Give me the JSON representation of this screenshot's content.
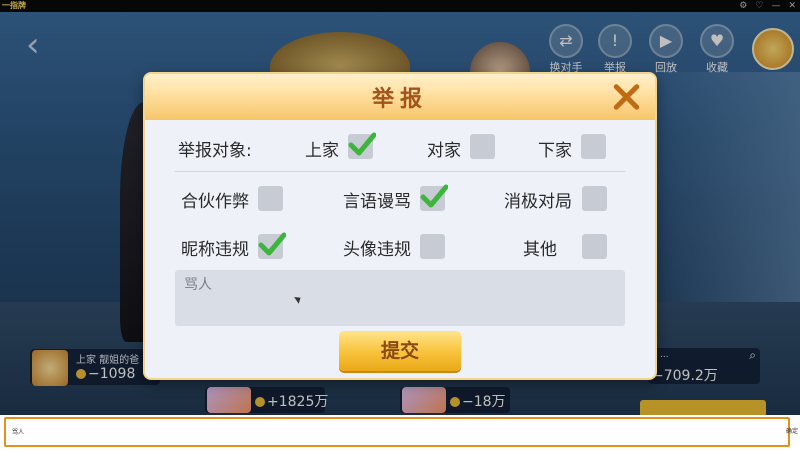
{
  "window": {
    "app_title": "一指牌",
    "controls": [
      "⚙",
      "♡",
      "—",
      "✕"
    ]
  },
  "top_buttons": [
    {
      "label": "换对手",
      "icon": "swap-icon"
    },
    {
      "label": "举报",
      "icon": "report-icon"
    },
    {
      "label": "回放",
      "icon": "play-icon"
    },
    {
      "label": "收藏",
      "icon": "heart-icon"
    }
  ],
  "players": {
    "left": {
      "name": "上家 靓姐的爸",
      "score": "−1098"
    },
    "right": {
      "dots": "...",
      "score": "−709.2万"
    },
    "bottom1": {
      "score": "+1825万"
    },
    "bottom2": {
      "score": "−18万"
    }
  },
  "dialog": {
    "title": "举报",
    "target_label": "举报对象:",
    "targets": [
      {
        "label": "上家",
        "checked": true
      },
      {
        "label": "对家",
        "checked": false
      },
      {
        "label": "下家",
        "checked": false
      }
    ],
    "reasons": [
      {
        "label": "合伙作弊",
        "checked": false
      },
      {
        "label": "言语谩骂",
        "checked": true
      },
      {
        "label": "消极对局",
        "checked": false
      },
      {
        "label": "昵称违规",
        "checked": true
      },
      {
        "label": "头像违规",
        "checked": false
      },
      {
        "label": "其他",
        "checked": false
      }
    ],
    "comment_text": "骂人",
    "submit_label": "提交"
  },
  "chat": {
    "input_text": "骂人",
    "send_label": "确定"
  },
  "colors": {
    "header_gold": "#f6c56a",
    "title_brown": "#a2541c",
    "check_green": "#3cb53c",
    "submit_yellow": "#f8c23a",
    "chat_border": "#e8901e"
  }
}
